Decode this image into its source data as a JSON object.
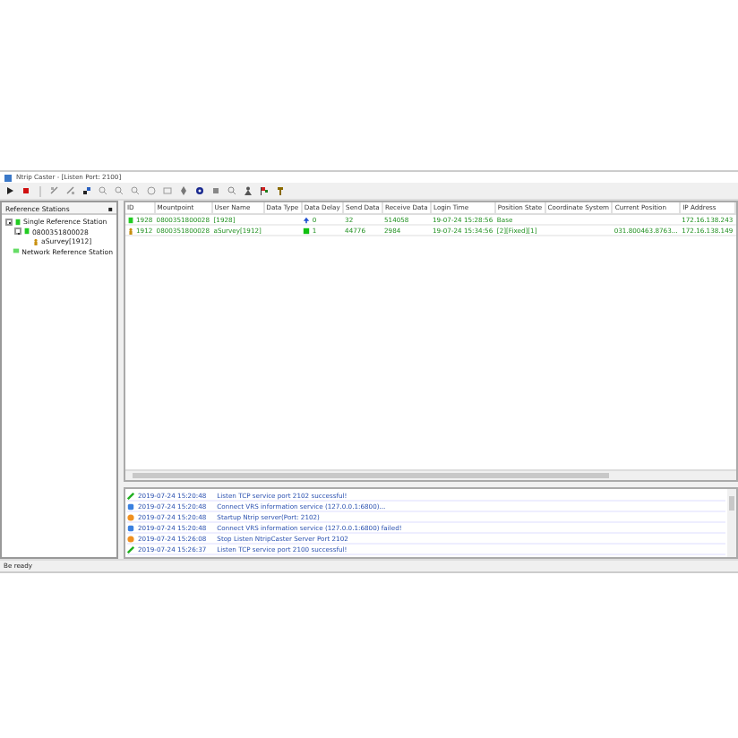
{
  "window": {
    "title": "Ntrip Caster - [Listen Port: 2100]"
  },
  "sidebar": {
    "title": "Reference Stations",
    "pin": "▪",
    "tree": [
      {
        "label": "Single Reference Station",
        "kind": "group",
        "expanded": true,
        "children": [
          {
            "label": "0800351800028",
            "kind": "station",
            "expanded": true,
            "children": [
              {
                "label": "aSurvey[1912]",
                "kind": "user"
              }
            ]
          }
        ]
      },
      {
        "label": "Network Reference Station",
        "kind": "network"
      }
    ]
  },
  "table": {
    "columns": [
      "ID",
      "Mountpoint",
      "User Name",
      "Data Type",
      "Data Delay",
      "Send Data",
      "Receive Data",
      "Login Time",
      "Position State",
      "Coordinate System",
      "Current Position",
      "IP Address"
    ],
    "rows": [
      {
        "kind": "base",
        "delay": {
          "kind": "up"
        },
        "cells": [
          "1928",
          "0800351800028",
          "[1928]",
          "",
          "0",
          "32",
          "514058",
          "19-07-24 15:28:56",
          "Base",
          "",
          "",
          "172.16.138.243"
        ]
      },
      {
        "kind": "rover",
        "delay": {
          "kind": "ok"
        },
        "cells": [
          "1912",
          "0800351800028",
          "aSurvey[1912]",
          "",
          "1",
          "44776",
          "2984",
          "19-07-24 15:34:56",
          "[2][Fixed][1]",
          "",
          "031.800463.8763...",
          "172.16.138.149"
        ]
      }
    ]
  },
  "log": [
    {
      "kind": "success",
      "time": "2019-07-24 15:20:48",
      "message": "Listen TCP service port 2102 successful!"
    },
    {
      "kind": "info",
      "time": "2019-07-24 15:20:48",
      "message": "Connect VRS information service (127.0.0.1:6800)..."
    },
    {
      "kind": "warning",
      "time": "2019-07-24 15:20:48",
      "message": "Startup Ntrip server(Port: 2102)"
    },
    {
      "kind": "info",
      "time": "2019-07-24 15:20:48",
      "message": "Connect VRS information service (127.0.0.1:6800) failed!"
    },
    {
      "kind": "warning",
      "time": "2019-07-24 15:26:08",
      "message": "Stop Listen NtripCaster Server Port 2102"
    },
    {
      "kind": "success",
      "time": "2019-07-24 15:26:37",
      "message": "Listen TCP service port 2100 successful!"
    }
  ],
  "status_bar": {
    "text": "Be ready"
  }
}
